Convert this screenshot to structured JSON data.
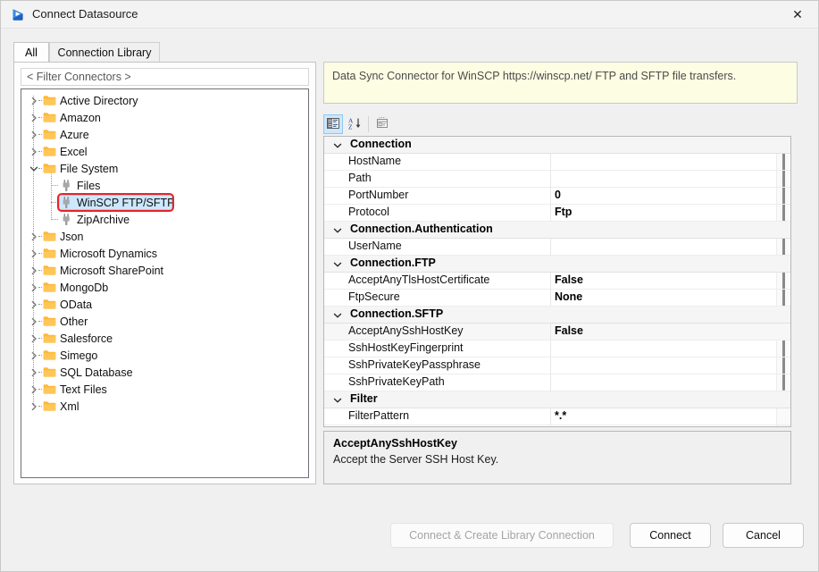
{
  "window": {
    "title": "Connect Datasource",
    "logo_icon": "play-triangle-logo",
    "close_icon": "close-icon"
  },
  "tabs": [
    {
      "label": "All",
      "active": true
    },
    {
      "label": "Connection Library",
      "active": false
    }
  ],
  "filter": {
    "value": "< Filter Connectors >",
    "placeholder": "< Filter Connectors >"
  },
  "tree": {
    "items": [
      {
        "label": "Active Directory",
        "depth": 0,
        "type": "folder",
        "expanded": false,
        "selected": false
      },
      {
        "label": "Amazon",
        "depth": 0,
        "type": "folder",
        "expanded": false,
        "selected": false
      },
      {
        "label": "Azure",
        "depth": 0,
        "type": "folder",
        "expanded": false,
        "selected": false
      },
      {
        "label": "Excel",
        "depth": 0,
        "type": "folder",
        "expanded": false,
        "selected": false
      },
      {
        "label": "File System",
        "depth": 0,
        "type": "folder",
        "expanded": true,
        "selected": false
      },
      {
        "label": "Files",
        "depth": 1,
        "type": "connector",
        "expanded": null,
        "selected": false
      },
      {
        "label": "WinSCP FTP/SFTP",
        "depth": 1,
        "type": "connector",
        "expanded": null,
        "selected": true,
        "annotated": true
      },
      {
        "label": "ZipArchive",
        "depth": 1,
        "type": "connector",
        "expanded": null,
        "selected": false
      },
      {
        "label": "Json",
        "depth": 0,
        "type": "folder",
        "expanded": false,
        "selected": false
      },
      {
        "label": "Microsoft Dynamics",
        "depth": 0,
        "type": "folder",
        "expanded": false,
        "selected": false
      },
      {
        "label": "Microsoft SharePoint",
        "depth": 0,
        "type": "folder",
        "expanded": false,
        "selected": false
      },
      {
        "label": "MongoDb",
        "depth": 0,
        "type": "folder",
        "expanded": false,
        "selected": false
      },
      {
        "label": "OData",
        "depth": 0,
        "type": "folder",
        "expanded": false,
        "selected": false
      },
      {
        "label": "Other",
        "depth": 0,
        "type": "folder",
        "expanded": false,
        "selected": false
      },
      {
        "label": "Salesforce",
        "depth": 0,
        "type": "folder",
        "expanded": false,
        "selected": false
      },
      {
        "label": "Simego",
        "depth": 0,
        "type": "folder",
        "expanded": false,
        "selected": false
      },
      {
        "label": "SQL Database",
        "depth": 0,
        "type": "folder",
        "expanded": false,
        "selected": false
      },
      {
        "label": "Text Files",
        "depth": 0,
        "type": "folder",
        "expanded": false,
        "selected": false
      },
      {
        "label": "Xml",
        "depth": 0,
        "type": "folder",
        "expanded": false,
        "selected": false
      }
    ]
  },
  "banner": {
    "text": "Data Sync Connector for WinSCP https://winscp.net/ FTP and SFTP file transfers."
  },
  "propertygrid": {
    "toolbar": [
      {
        "icon": "categorized-view-icon",
        "pressed": true
      },
      {
        "icon": "alphabetical-sort-icon",
        "pressed": false
      },
      {
        "icon": "property-pages-icon",
        "pressed": false
      }
    ],
    "rows": [
      {
        "kind": "category",
        "name": "Connection",
        "value": "",
        "expanded": true
      },
      {
        "kind": "property",
        "name": "HostName",
        "value": ""
      },
      {
        "kind": "property",
        "name": "Path",
        "value": ""
      },
      {
        "kind": "property",
        "name": "PortNumber",
        "value": "0"
      },
      {
        "kind": "property",
        "name": "Protocol",
        "value": "Ftp"
      },
      {
        "kind": "category",
        "name": "Connection.Authentication",
        "value": "",
        "expanded": true
      },
      {
        "kind": "property",
        "name": "UserName",
        "value": ""
      },
      {
        "kind": "category",
        "name": "Connection.FTP",
        "value": "",
        "expanded": true
      },
      {
        "kind": "property",
        "name": "AcceptAnyTlsHostCertificate",
        "value": "False"
      },
      {
        "kind": "property",
        "name": "FtpSecure",
        "value": "None"
      },
      {
        "kind": "category",
        "name": "Connection.SFTP",
        "value": "",
        "expanded": true
      },
      {
        "kind": "property",
        "name": "AcceptAnySshHostKey",
        "value": "False",
        "selected": true
      },
      {
        "kind": "property",
        "name": "SshHostKeyFingerprint",
        "value": ""
      },
      {
        "kind": "property",
        "name": "SshPrivateKeyPassphrase",
        "value": ""
      },
      {
        "kind": "property",
        "name": "SshPrivateKeyPath",
        "value": ""
      },
      {
        "kind": "category",
        "name": "Filter",
        "value": "",
        "expanded": true
      },
      {
        "kind": "property",
        "name": "FilterPattern",
        "value": "*.*"
      }
    ]
  },
  "description": {
    "title": "AcceptAnySshHostKey",
    "body": "Accept the Server SSH Host Key."
  },
  "footer": {
    "connect_create_label": "Connect & Create Library Connection",
    "connect_label": "Connect",
    "cancel_label": "Cancel"
  },
  "colors": {
    "selection": "#cce8ff",
    "annotation": "#ee2222",
    "banner_bg": "#fdfde3",
    "folder": "#ffb936"
  }
}
